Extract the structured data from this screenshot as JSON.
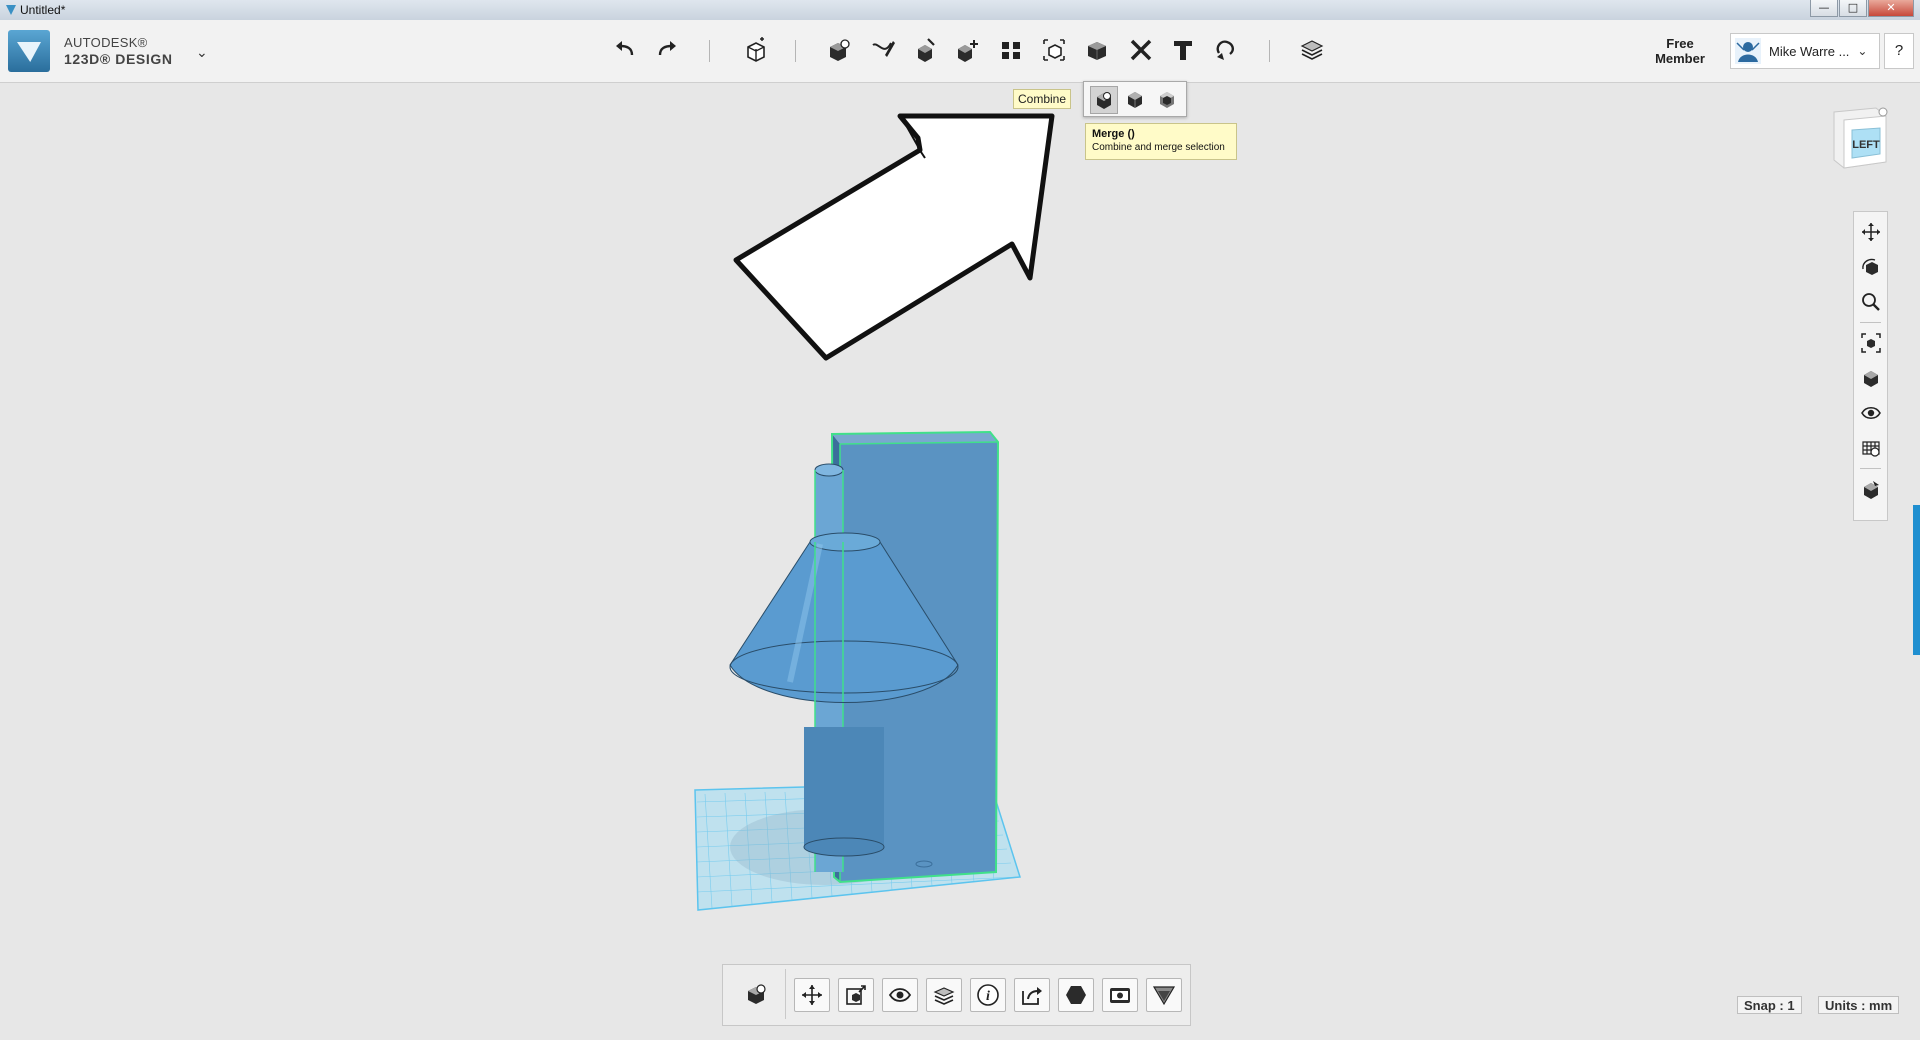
{
  "window": {
    "title": "Untitled*",
    "controls": {
      "minimize": "—",
      "maximize": "□",
      "close": "✕"
    }
  },
  "brand": {
    "line1": "AUTODESK®",
    "line2": "123D® DESIGN",
    "menu_icon": "chevron-down-icon"
  },
  "toolbar": {
    "tools": [
      {
        "name": "undo",
        "icon": "undo-icon"
      },
      {
        "name": "redo",
        "icon": "redo-icon"
      },
      {
        "name": "transform",
        "icon": "transform-icon"
      },
      {
        "name": "primitives",
        "icon": "primitives-icon"
      },
      {
        "name": "sketch",
        "icon": "sketch-icon"
      },
      {
        "name": "construct",
        "icon": "construct-icon"
      },
      {
        "name": "modify",
        "icon": "modify-icon"
      },
      {
        "name": "pattern",
        "icon": "pattern-icon"
      },
      {
        "name": "grouping",
        "icon": "grouping-icon"
      },
      {
        "name": "combine",
        "icon": "combine-icon"
      },
      {
        "name": "measure",
        "icon": "measure-icon"
      },
      {
        "name": "text",
        "icon": "text-icon"
      },
      {
        "name": "snap",
        "icon": "snap-icon"
      },
      {
        "name": "material",
        "icon": "material-icon"
      }
    ]
  },
  "account": {
    "free_member": "Free\nMember",
    "user_name": "Mike Warre ...",
    "help": "?"
  },
  "combine_popup": {
    "label": "Combine",
    "options": [
      {
        "name": "merge",
        "icon": "merge-icon",
        "active": true
      },
      {
        "name": "subtract",
        "icon": "subtract-icon",
        "active": false
      },
      {
        "name": "intersect",
        "icon": "intersect-icon",
        "active": false
      }
    ],
    "tooltip_title": "Merge ()",
    "tooltip_desc": "Combine and merge selection"
  },
  "viewcube": {
    "face": "LEFT"
  },
  "nav_tools": [
    {
      "name": "pan",
      "icon": "pan-icon"
    },
    {
      "name": "orbit",
      "icon": "orbit-icon"
    },
    {
      "name": "zoom",
      "icon": "zoom-icon"
    },
    {
      "name": "fit",
      "icon": "fit-icon"
    },
    {
      "name": "perspective",
      "icon": "perspective-icon"
    },
    {
      "name": "visibility",
      "icon": "eye-icon"
    },
    {
      "name": "grid-settings",
      "icon": "grid-icon"
    },
    {
      "name": "material-view",
      "icon": "material-view-icon"
    }
  ],
  "bottom_tools": [
    {
      "name": "selection-cube",
      "icon": "selection-cube-icon"
    },
    {
      "name": "move",
      "icon": "move-icon"
    },
    {
      "name": "scale",
      "icon": "scale-icon"
    },
    {
      "name": "hide",
      "icon": "eye-icon"
    },
    {
      "name": "material",
      "icon": "material-icon"
    },
    {
      "name": "info",
      "icon": "info-icon"
    },
    {
      "name": "export",
      "icon": "export-icon"
    },
    {
      "name": "solid",
      "icon": "solid-icon"
    },
    {
      "name": "screenshot",
      "icon": "camera-icon"
    },
    {
      "name": "meshmixer",
      "icon": "meshmixer-icon"
    }
  ],
  "status": {
    "snap": "Snap : 1",
    "units": "Units : mm"
  },
  "colors": {
    "model": "#5a93c2",
    "model_dark": "#3b6f9b",
    "selection": "#40e08a",
    "grid": "#5cc4ee",
    "background": "#e7e7e7",
    "accent": "#1f8fd0"
  }
}
